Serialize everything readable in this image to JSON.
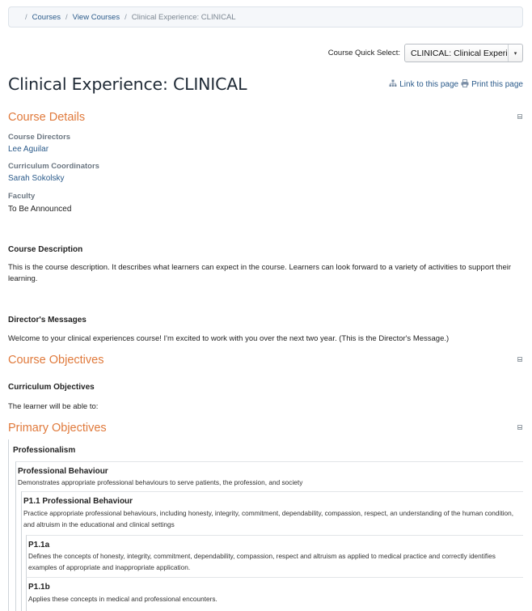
{
  "breadcrumb": {
    "items": [
      "Courses",
      "View Courses"
    ],
    "current": "Clinical Experience: CLINICAL"
  },
  "quick_select": {
    "label": "Course Quick Select:",
    "value": "CLINICAL: Clinical Experie"
  },
  "page": {
    "title": "Clinical Experience: CLINICAL",
    "link_label": "Link to this page",
    "print_label": "Print this page"
  },
  "course_details": {
    "heading": "Course Details",
    "directors_label": "Course Directors",
    "director": "Lee Aguilar",
    "coordinators_label": "Curriculum Coordinators",
    "coordinator": "Sarah Sokolsky",
    "faculty_label": "Faculty",
    "faculty": "To Be Announced",
    "description_heading": "Course Description",
    "description": "This is the course description.  It describes what learners can expect in the course.  Learners can look forward to a variety of activities to support their learning.",
    "messages_heading": "Director's Messages",
    "message": "Welcome to your clinical experiences course!  I'm excited to work with you over the next two year.  (This is the Director's Message.)"
  },
  "course_objectives": {
    "heading": "Course Objectives",
    "curriculum_heading": "Curriculum Objectives",
    "intro": "The learner will be able to:"
  },
  "primary_objectives": {
    "heading": "Primary Objectives",
    "root": "Professionalism",
    "level1_title": "Professional Behaviour",
    "level1_desc": "Demonstrates appropriate professional behaviours to serve patients, the profession, and society",
    "level2_title": "P1.1 Professional Behaviour",
    "level2_desc": "Practice appropriate professional behaviours, including honesty, integrity, commitment, dependability, compassion, respect, an understanding of the human condition, and altruism in the educational and clinical settings",
    "level3a_title": "P1.1a",
    "level3a_desc": "Defines the concepts of honesty, integrity, commitment, dependability, compassion, respect and altruism as applied to medical practice and correctly identifies examples of appropriate and inappropriate application.",
    "level3b_title": "P1.1b",
    "level3b_desc": "Applies these concepts in medical and professional encounters."
  },
  "colors": {
    "section_heading": "#e07a3c",
    "link": "#2a5a8a"
  }
}
